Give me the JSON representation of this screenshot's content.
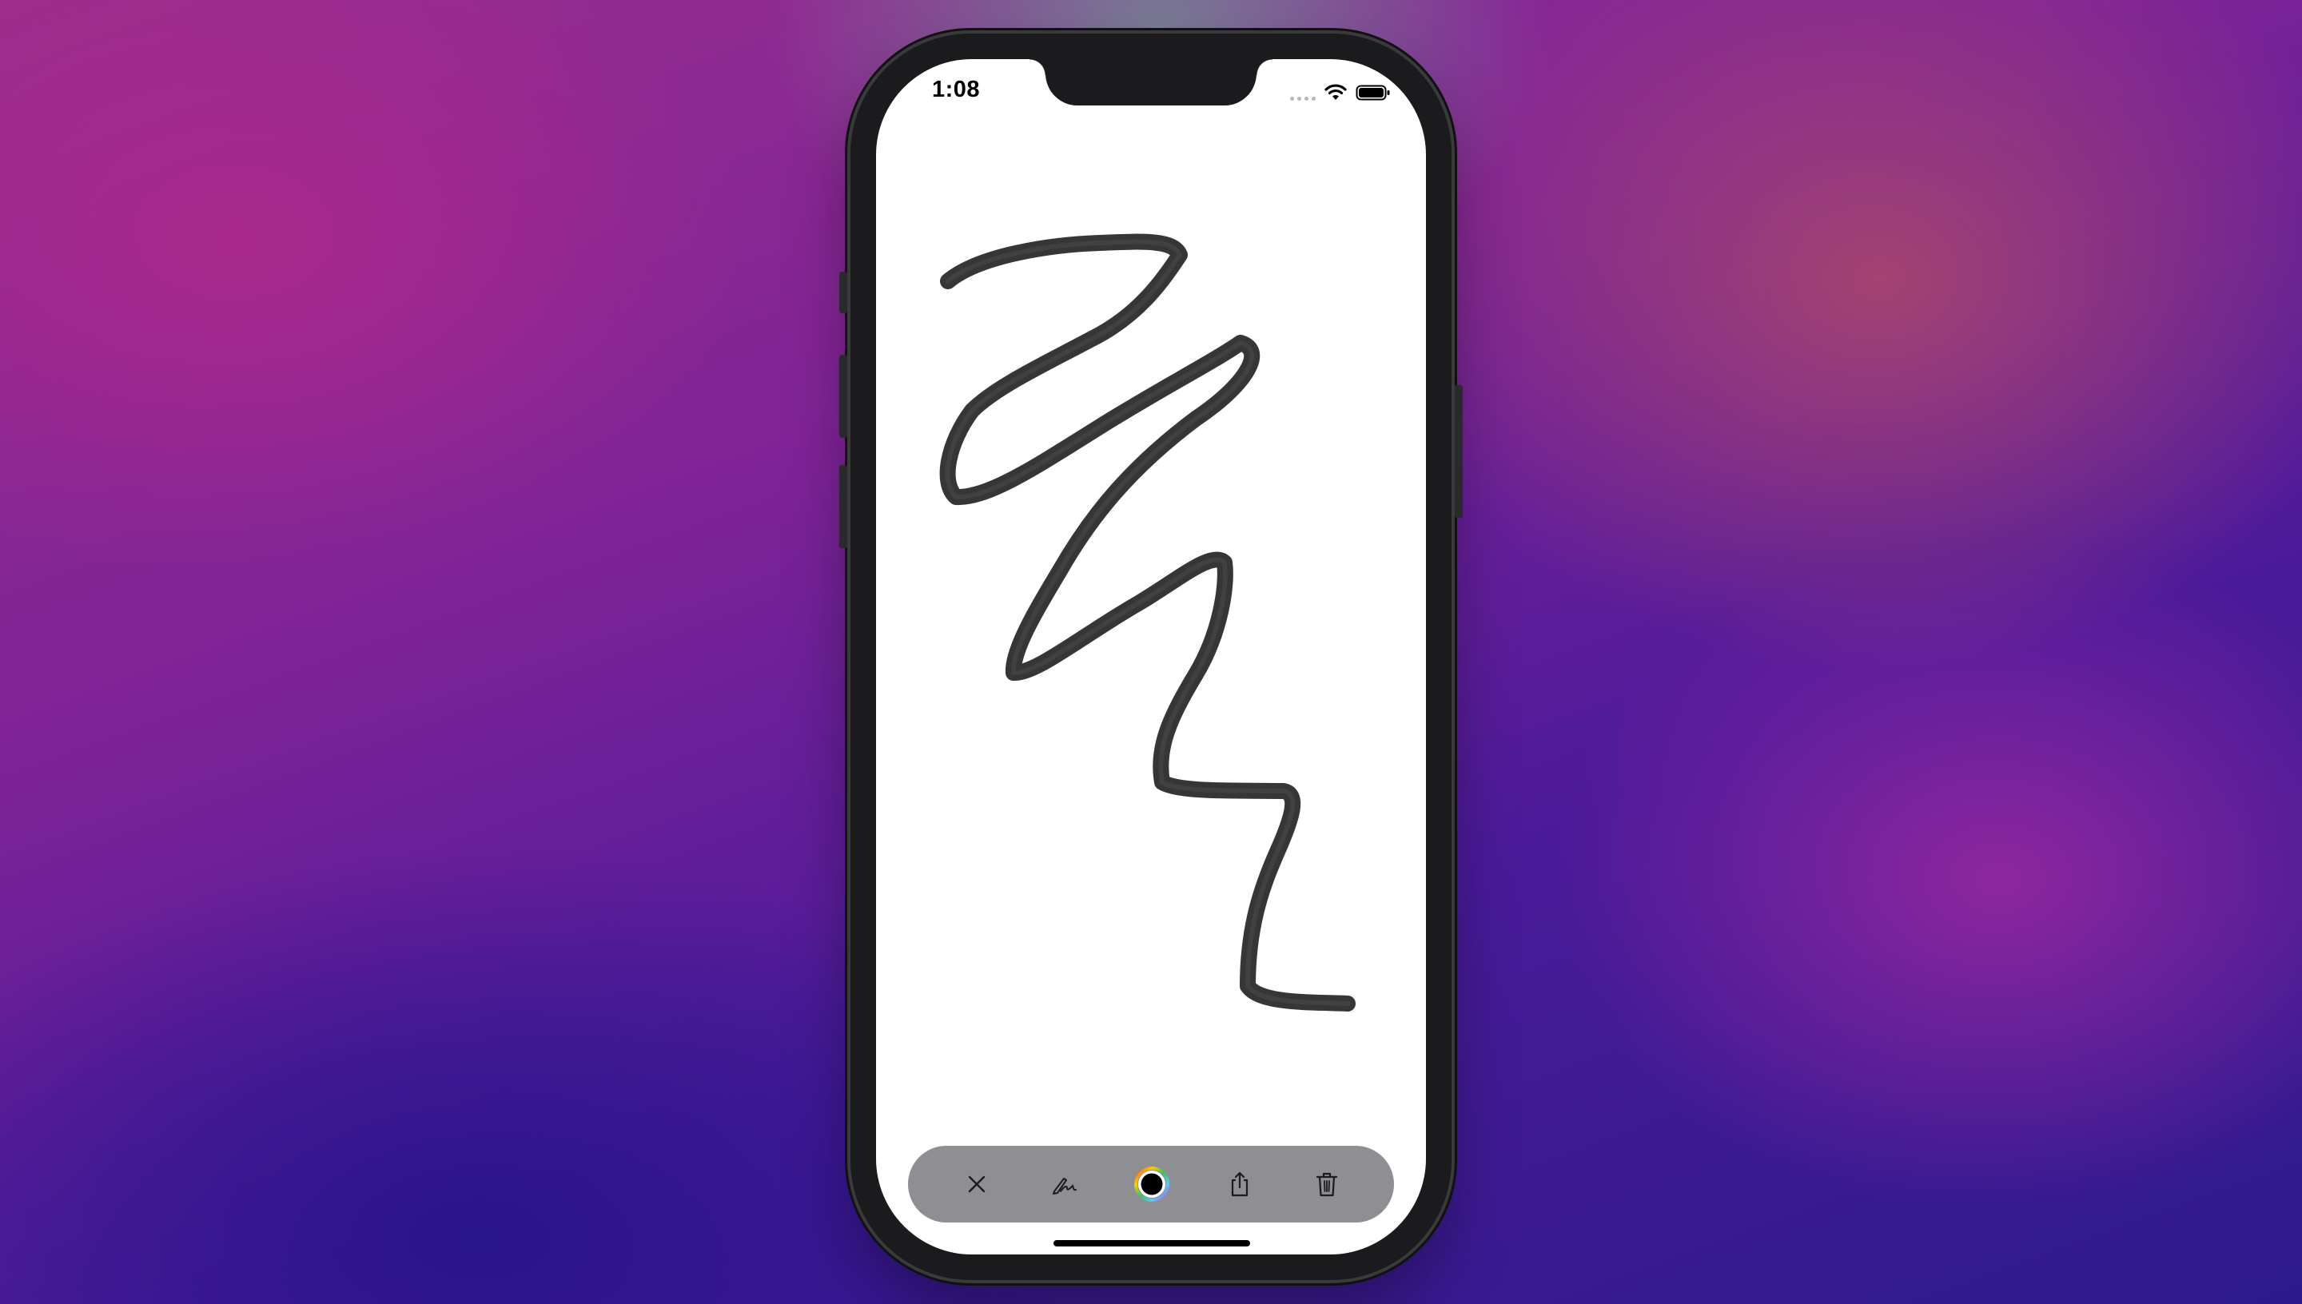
{
  "status_bar": {
    "time": "1:08"
  },
  "icons": {
    "wifi": "wifi-icon",
    "battery": "battery-icon",
    "signal": "signal-dots-icon"
  },
  "toolbar": {
    "items": [
      {
        "name": "close",
        "icon": "xmark-icon"
      },
      {
        "name": "pen",
        "icon": "pen-scribble-icon"
      },
      {
        "name": "color",
        "icon": "color-wheel-icon",
        "selected_color": "#000000"
      },
      {
        "name": "share",
        "icon": "share-icon"
      },
      {
        "name": "delete",
        "icon": "trash-icon"
      }
    ]
  },
  "canvas": {
    "stroke_color": "#2b2b2b"
  }
}
